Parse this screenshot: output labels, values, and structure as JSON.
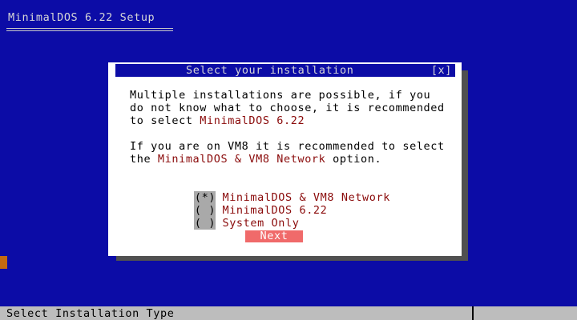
{
  "app": {
    "title": "MinimalDOS 6.22 Setup"
  },
  "dialog": {
    "title": "Select your installation",
    "close_label": "[x]",
    "para1": {
      "line1": "Multiple installations are possible, if you",
      "line2": "do not know what to choose, it is recommended",
      "line3_prefix": "to select ",
      "line3_highlight": "MinimalDOS 6.22"
    },
    "para2": {
      "line1": "If you are on VM8 it is recommended to select",
      "line2_prefix": "the ",
      "line2_highlight": "MinimalDOS & VM8 Network",
      "line2_suffix": " option."
    },
    "options": [
      {
        "marker": "(*)",
        "label": "MinimalDOS & VM8 Network",
        "selected": true
      },
      {
        "marker": "( )",
        "label": "MinimalDOS 6.22",
        "selected": false
      },
      {
        "marker": "( )",
        "label": "System Only",
        "selected": false
      }
    ],
    "next_label": "Next"
  },
  "status_bar": {
    "text": "Select Installation Type"
  },
  "colors": {
    "background": "#0c0ca6",
    "highlight": "#8a0a0a",
    "button": "#f06a6a",
    "status_bar": "#bdbdbd"
  }
}
